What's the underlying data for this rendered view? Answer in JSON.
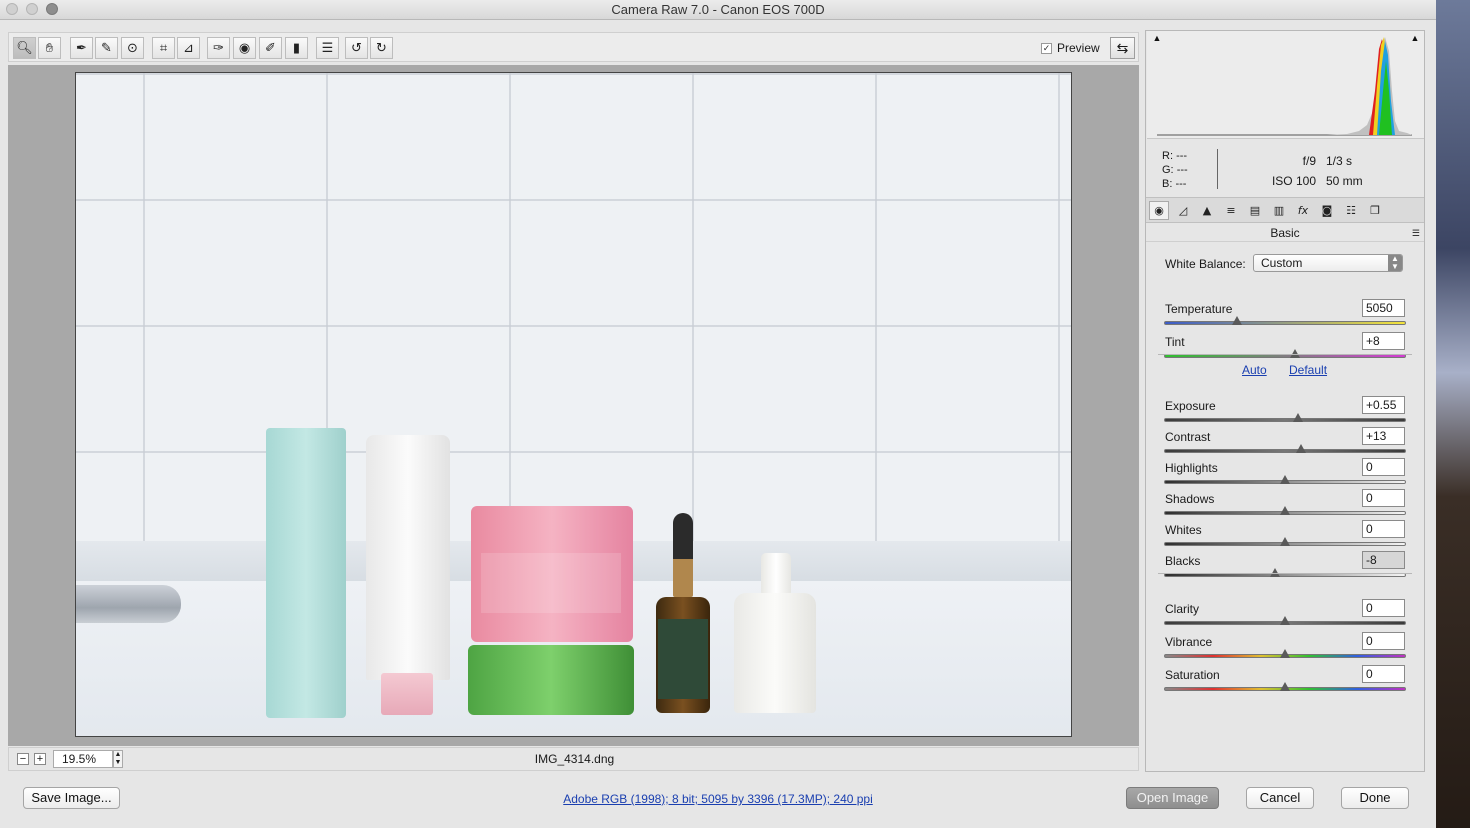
{
  "window": {
    "title": "Camera Raw 7.0  -  Canon EOS 700D"
  },
  "toolbar": {
    "tools": [
      "zoom-tool",
      "hand-tool",
      "white-balance-tool",
      "color-sampler-tool",
      "target-adjustment-tool",
      "crop-tool",
      "straighten-tool",
      "spot-removal-tool",
      "red-eye-tool",
      "adjustment-brush-tool",
      "graduated-filter-tool",
      "preferences",
      "rotate-left",
      "rotate-right"
    ],
    "preview_label": "Preview",
    "preview_checked": "✓"
  },
  "canvas": {
    "zoom_out": "−",
    "zoom_in": "+",
    "zoom_value": "19.5%",
    "filename": "IMG_4314.dng"
  },
  "histogram": {
    "r_label": "R:",
    "r_value": "---",
    "g_label": "G:",
    "g_value": "---",
    "b_label": "B:",
    "b_value": "---",
    "aperture": "f/9",
    "shutter": "1/3 s",
    "iso": "ISO 100",
    "focal": "50 mm"
  },
  "panel": {
    "title": "Basic",
    "white_balance_label": "White Balance:",
    "white_balance_value": "Custom",
    "auto_label": "Auto",
    "default_label": "Default",
    "sliders": [
      {
        "label": "Temperature",
        "value": "5050",
        "level": 0.3
      },
      {
        "label": "Tint",
        "value": "+8",
        "level": 0.54
      },
      {
        "label": "Exposure",
        "value": "+0.55",
        "level": 0.555
      },
      {
        "label": "Contrast",
        "value": "+13",
        "level": 0.565
      },
      {
        "label": "Highlights",
        "value": "0",
        "level": 0.5
      },
      {
        "label": "Shadows",
        "value": "0",
        "level": 0.5
      },
      {
        "label": "Whites",
        "value": "0",
        "level": 0.5
      },
      {
        "label": "Blacks",
        "value": "-8",
        "level": 0.46
      },
      {
        "label": "Clarity",
        "value": "0",
        "level": 0.5
      },
      {
        "label": "Vibrance",
        "value": "0",
        "level": 0.5
      },
      {
        "label": "Saturation",
        "value": "0",
        "level": 0.5
      }
    ]
  },
  "footer": {
    "save_label": "Save Image...",
    "workflow": "Adobe RGB (1998); 8 bit; 5095 by 3396 (17.3MP); 240 ppi",
    "open_label": "Open Image",
    "cancel_label": "Cancel",
    "done_label": "Done"
  }
}
